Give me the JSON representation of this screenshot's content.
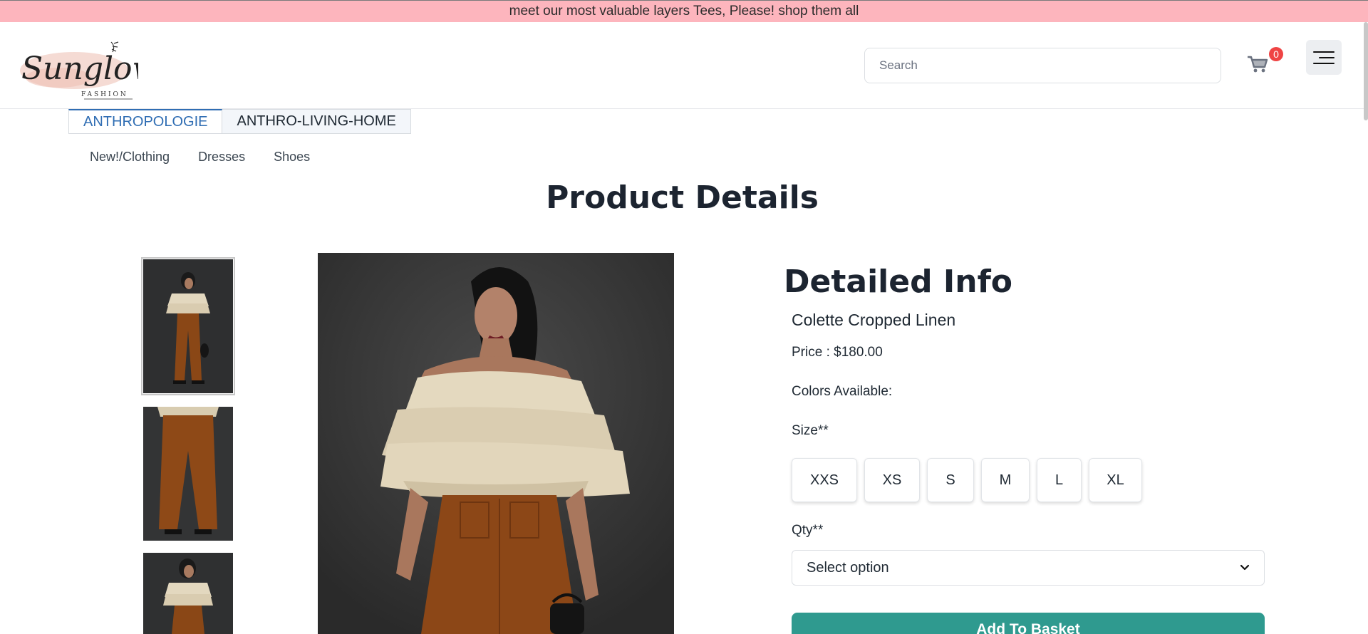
{
  "announcement": {
    "text": "meet our most valuable layers Tees, Please! shop them all"
  },
  "header": {
    "logo": {
      "alt": "Sunglow Fashion",
      "name_text": "Sunglow",
      "tagline_text": "FASHION"
    },
    "search": {
      "placeholder": "Search",
      "value": ""
    },
    "cart": {
      "count": "0",
      "icon": "cart-icon"
    },
    "menu": {
      "icon": "hamburger-icon"
    }
  },
  "tabs": [
    {
      "label": "ANTHROPOLOGIE",
      "active": true
    },
    {
      "label": "ANTHRO-LIVING-HOME",
      "active": false
    }
  ],
  "subnav": [
    {
      "label": "New!/Clothing"
    },
    {
      "label": "Dresses"
    },
    {
      "label": "Shoes"
    }
  ],
  "page": {
    "title": "Product Details"
  },
  "gallery": {
    "thumbnails": [
      {
        "alt": "Model wearing ruffle top and rust wide-leg pants, full length",
        "selected": true
      },
      {
        "alt": "Rust wide-leg pants, lower body view",
        "selected": false
      },
      {
        "alt": "Model wearing ruffle top and rust pants",
        "selected": false
      }
    ],
    "main_image": {
      "alt": "Colette Cropped Linen"
    }
  },
  "product": {
    "section_title": "Detailed Info",
    "name": "Colette Cropped Linen",
    "price_text": "Price : $180.00",
    "colors_label": "Colors Available:",
    "size_label": "Size**",
    "sizes": [
      "XXS",
      "XS",
      "S",
      "M",
      "L",
      "XL"
    ],
    "qty_label": "Qty**",
    "qty_select": {
      "value": "Select option",
      "icon": "chevron-down-icon"
    },
    "add_button_label": "Add To Basket"
  },
  "colors": {
    "announcement_bg": "#fdb5bd",
    "tab_accent": "#2f6db3",
    "cart_badge": "#ef4444",
    "primary_button": "#2f9a8f"
  }
}
